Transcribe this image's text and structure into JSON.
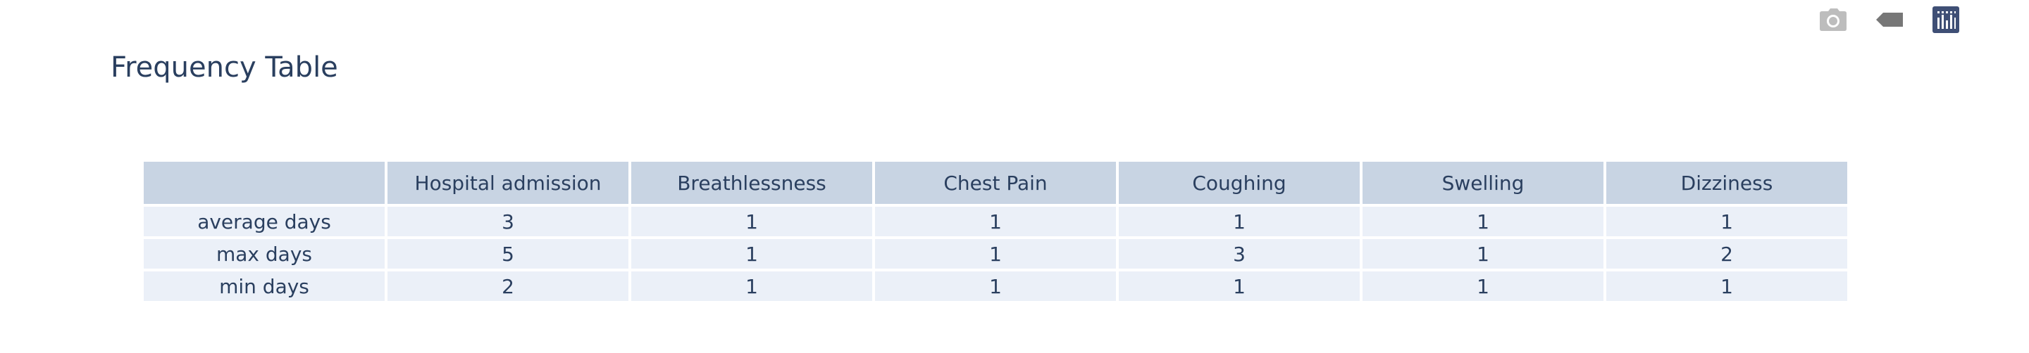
{
  "modebar": {
    "icons": [
      "camera-icon",
      "tag-icon",
      "plotly-logo-icon"
    ],
    "colors": {
      "icon": "#bdbdbd",
      "tag": "#777777",
      "logo_bg": "#3f4f75",
      "logo_fg": "#ffffff"
    }
  },
  "chart_data": {
    "type": "table",
    "title": "Frequency Table",
    "columns": [
      "",
      "Hospital admission",
      "Breathlessness",
      "Chest Pain",
      "Coughing",
      "Swelling",
      "Dizziness"
    ],
    "rows": [
      {
        "label": "average days",
        "values": [
          "3",
          "1",
          "1",
          "1",
          "1",
          "1"
        ]
      },
      {
        "label": "max days",
        "values": [
          "5",
          "1",
          "1",
          "3",
          "1",
          "2"
        ]
      },
      {
        "label": "min days",
        "values": [
          "2",
          "1",
          "1",
          "1",
          "1",
          "1"
        ]
      }
    ],
    "colors": {
      "header_fill": "#c8d4e3",
      "cell_fill": "#ebf0f8",
      "font": "#2a3f5f",
      "line": "#ffffff"
    }
  }
}
